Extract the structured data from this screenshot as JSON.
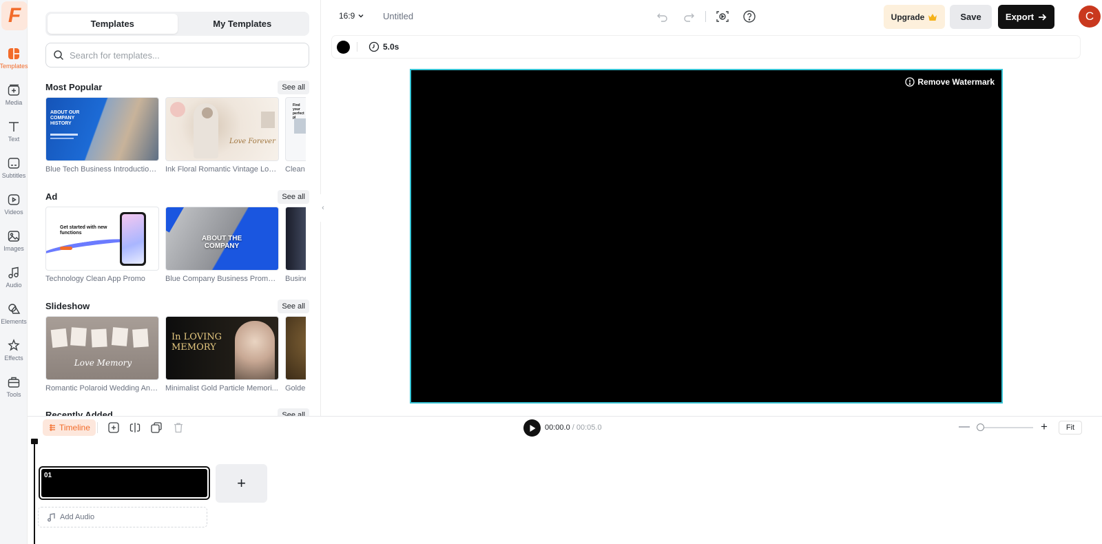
{
  "sidebar": {
    "items": [
      {
        "label": "Templates",
        "icon": "templates-icon",
        "active": true
      },
      {
        "label": "Media",
        "icon": "media-icon"
      },
      {
        "label": "Text",
        "icon": "text-icon"
      },
      {
        "label": "Subtitles",
        "icon": "subtitles-icon"
      },
      {
        "label": "Videos",
        "icon": "videos-icon"
      },
      {
        "label": "Images",
        "icon": "images-icon"
      },
      {
        "label": "Audio",
        "icon": "audio-icon"
      },
      {
        "label": "Elements",
        "icon": "elements-icon"
      },
      {
        "label": "Effects",
        "icon": "effects-icon"
      },
      {
        "label": "Tools",
        "icon": "tools-icon"
      }
    ]
  },
  "panel": {
    "tabs": [
      "Templates",
      "My Templates"
    ],
    "search_placeholder": "Search for templates...",
    "sections": [
      {
        "title": "Most Popular",
        "see_all": "See all",
        "cards": [
          {
            "name": "Blue Tech Business Introduction ...",
            "thumb_text": "ABOUT OUR COMPANY HISTORY"
          },
          {
            "name": "Ink Floral Romantic Vintage Love...",
            "thumb_text": "Love Forever"
          },
          {
            "name": "Clean B",
            "thumb_text": "Find your perfect pl"
          }
        ]
      },
      {
        "title": "Ad",
        "see_all": "See all",
        "cards": [
          {
            "name": "Technology Clean App Promo",
            "thumb_text": "Get started with new functions"
          },
          {
            "name": "Blue Company Business Promo ...",
            "thumb_text": "ABOUT THE COMPANY"
          },
          {
            "name": "Busine",
            "thumb_text": ""
          }
        ]
      },
      {
        "title": "Slideshow",
        "see_all": "See all",
        "cards": [
          {
            "name": "Romantic Polaroid Wedding Anni...",
            "thumb_text": "Love Memory"
          },
          {
            "name": "Minimalist Gold Particle Memori...",
            "thumb_text": "In LOVING MEMORY"
          },
          {
            "name": "Golden",
            "thumb_text": ""
          }
        ]
      },
      {
        "title": "Recently Added",
        "see_all": "See all",
        "cards": []
      }
    ]
  },
  "topbar": {
    "aspect_ratio": "16:9",
    "project_title": "Untitled",
    "upgrade_label": "Upgrade",
    "save_label": "Save",
    "export_label": "Export",
    "avatar_initial": "C"
  },
  "properties": {
    "background_color": "#000000",
    "duration": "5.0s"
  },
  "canvas": {
    "watermark_label": "Remove Watermark",
    "background": "#000000",
    "selection_color": "#38c5d6"
  },
  "timeline": {
    "label": "Timeline",
    "current_time": "00:00.0",
    "total_time": "00:05.0",
    "fit_label": "Fit",
    "clips": [
      {
        "number": "01"
      }
    ],
    "add_audio_label": "Add Audio"
  },
  "colors": {
    "accent": "#f26b2a",
    "upgrade_bg": "#fdf0dc",
    "export_bg": "#111111",
    "avatar_bg": "#c9381e"
  }
}
